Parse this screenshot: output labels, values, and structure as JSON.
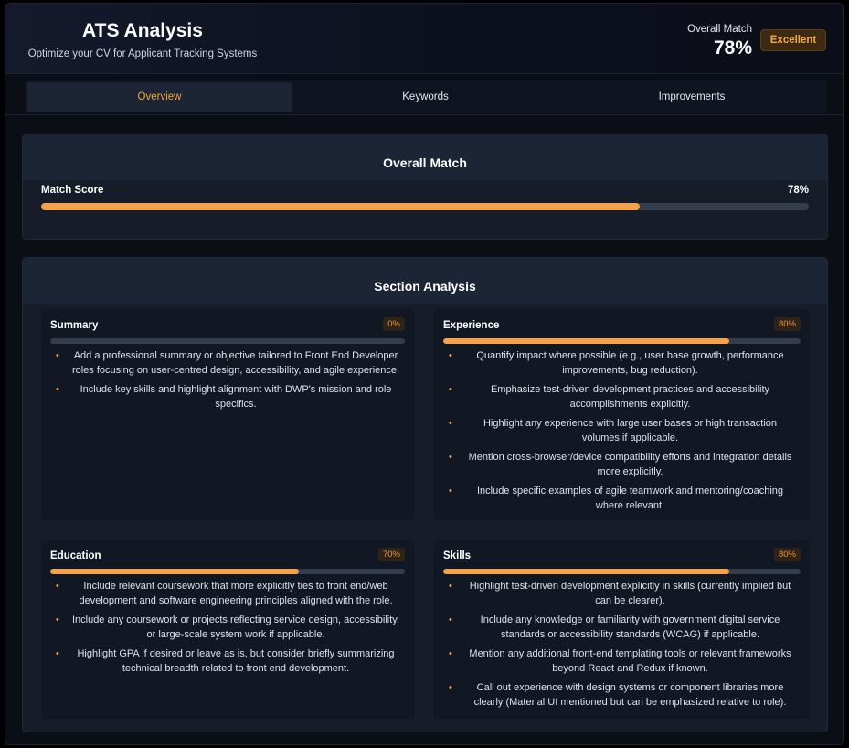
{
  "header": {
    "title": "ATS Analysis",
    "subtitle": "Optimize your CV for Applicant Tracking Systems",
    "overall_label": "Overall Match",
    "overall_value": "78%",
    "rating": "Excellent"
  },
  "tabs": [
    {
      "label": "Overview",
      "active": true
    },
    {
      "label": "Keywords",
      "active": false
    },
    {
      "label": "Improvements",
      "active": false
    }
  ],
  "overall_match": {
    "title": "Overall Match",
    "score_label": "Match Score",
    "score_text": "78%",
    "score_fraction": 0.78
  },
  "section_analysis": {
    "title": "Section Analysis",
    "sections": [
      {
        "name": "Summary",
        "percent_text": "0%",
        "fraction": 0.0,
        "items": [
          "Add a professional summary or objective tailored to Front End Developer roles focusing on user-centred design, accessibility, and agile experience.",
          "Include key skills and highlight alignment with DWP's mission and role specifics."
        ]
      },
      {
        "name": "Experience",
        "percent_text": "80%",
        "fraction": 0.8,
        "items": [
          "Quantify impact where possible (e.g., user base growth, performance improvements, bug reduction).",
          "Emphasize test-driven development practices and accessibility accomplishments explicitly.",
          "Highlight any experience with large user bases or high transaction volumes if applicable.",
          "Mention cross-browser/device compatibility efforts and integration details more explicitly.",
          "Include specific examples of agile teamwork and mentoring/coaching where relevant."
        ]
      },
      {
        "name": "Education",
        "percent_text": "70%",
        "fraction": 0.7,
        "items": [
          "Include relevant coursework that more explicitly ties to front end/web development and software engineering principles aligned with the role.",
          "Include any coursework or projects reflecting service design, accessibility, or large-scale system work if applicable.",
          "Highlight GPA if desired or leave as is, but consider briefly summarizing technical breadth related to front end development."
        ]
      },
      {
        "name": "Skills",
        "percent_text": "80%",
        "fraction": 0.8,
        "items": [
          "Highlight test-driven development explicitly in skills (currently implied but can be clearer).",
          "Include any knowledge or familiarity with government digital service standards or accessibility standards (WCAG) if applicable.",
          "Mention any additional front-end templating tools or relevant frameworks beyond React and Redux if known.",
          "Call out experience with design systems or component libraries more clearly (Material UI mentioned but can be emphasized relative to role)."
        ]
      }
    ]
  },
  "colors": {
    "accent": "#f5a34a",
    "badge_text": "#f5a93f",
    "track": "#333d4d",
    "card": "#161d29",
    "background": "#0b0e15"
  }
}
